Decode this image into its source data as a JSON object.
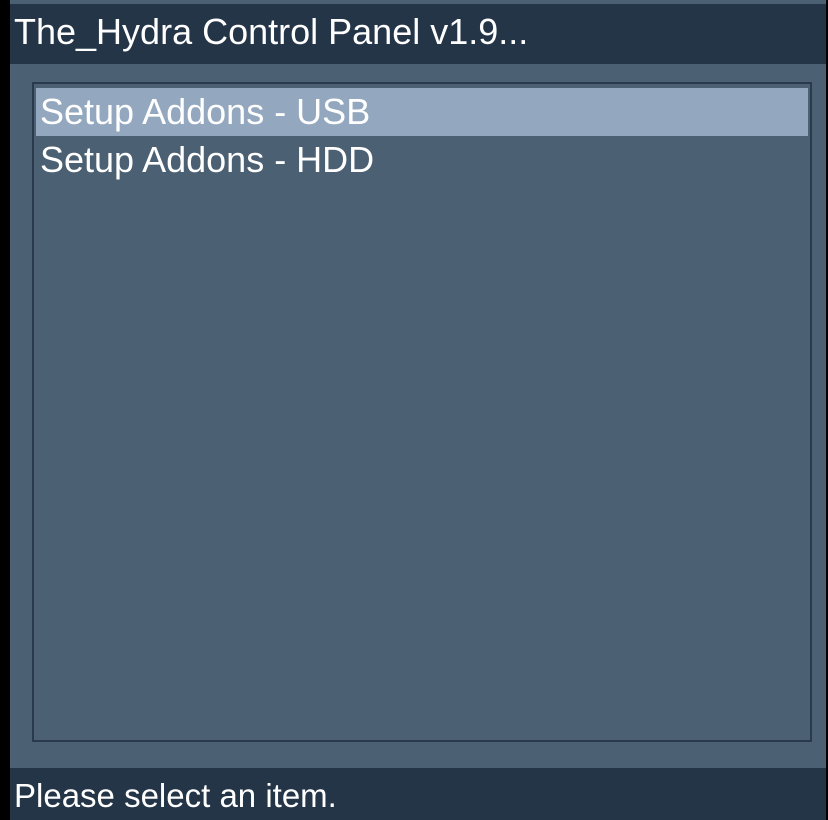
{
  "window": {
    "title": "The_Hydra Control Panel v1.9..."
  },
  "menu": {
    "items": [
      {
        "label": "Setup Addons - USB",
        "selected": true
      },
      {
        "label": "Setup Addons - HDD",
        "selected": false
      }
    ]
  },
  "status": {
    "text": "Please select an item."
  },
  "colors": {
    "background": "#000000",
    "panel": "#4b6072",
    "title_bar": "#243548",
    "selection": "#93a8bf",
    "text": "#ffffff"
  }
}
